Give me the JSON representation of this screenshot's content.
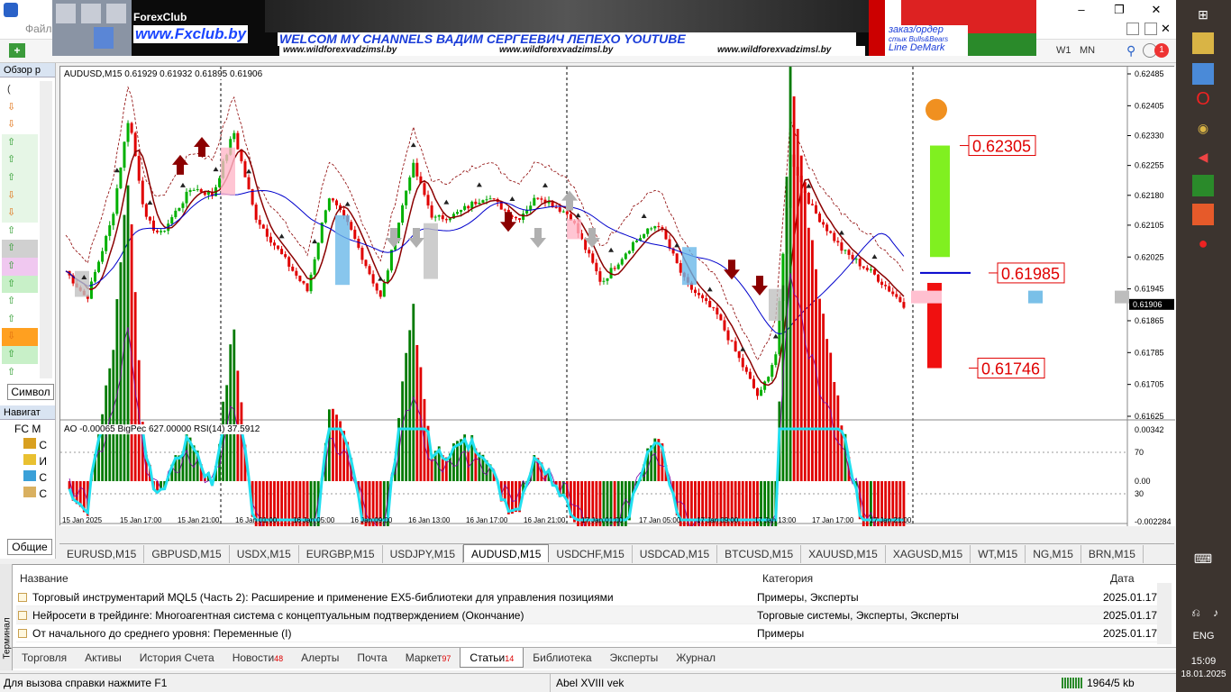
{
  "banner": {
    "forexclub": "ForexClub",
    "fxclub_url": "www.Fxclub.by",
    "headline": "WELCOM MY CHANNELS ВАДИМ СЕРГЕЕВИЧ ЛЕПЕХО YOUTUBE",
    "site1": "www.wildforexvadzimsl.by",
    "site2": "www.wildforexvadzimsl.by",
    "site3": "www.wildforexvadzimsl.by",
    "order": "заказ/ордер",
    "order2": "стык Bulls&Bears",
    "order3": "Line DeMark"
  },
  "menu": {
    "file": "Файл"
  },
  "toolbar": {
    "w1": "W1",
    "mn": "MN",
    "notif_count": "1"
  },
  "market_watch": {
    "title": "Обзор р",
    "symbol_tab": "Символ"
  },
  "navigator": {
    "title": "Навигат",
    "root": "FC M",
    "items": [
      "С",
      "И",
      "С",
      "С"
    ],
    "tab": "Общие"
  },
  "chart": {
    "header": "AUDUSD,M15  0.61929 0.61932 0.61895 0.61906",
    "indicator_header": "AO -0.00065  BigPec 627.00000  RSI(14) 37.5912",
    "price_labels": [
      "0.62485",
      "0.62405",
      "0.62330",
      "0.62255",
      "0.62180",
      "0.62105",
      "0.62025",
      "0.61945",
      "0.61865",
      "0.61785",
      "0.61705",
      "0.61625"
    ],
    "current_price": "0.61906",
    "level_high": "0.62305",
    "level_mid": "0.61985",
    "level_low": "0.61746",
    "ind_labels": [
      "0.00342",
      "70",
      "0.00",
      "30",
      "-0.002284"
    ],
    "time_labels": [
      "15 Jan 2025",
      "15 Jan 17:00",
      "15 Jan 21:00",
      "16 Jan 01:00",
      "16 Jan 05:00",
      "16 Jan 09:00",
      "16 Jan 13:00",
      "16 Jan 17:00",
      "16 Jan 21:00",
      "17 Jan 01:00",
      "17 Jan 05:00",
      "17 Jan 09:00",
      "17 Jan 13:00",
      "17 Jan 17:00",
      "17 Jan 21:00"
    ]
  },
  "symbol_tabs": [
    "EURUSD,M15",
    "GBPUSD,M15",
    "USDX,M15",
    "EURGBP,M15",
    "USDJPY,M15",
    "AUDUSD,M15",
    "USDCHF,M15",
    "USDCAD,M15",
    "BTCUSD,M15",
    "XAUUSD,M15",
    "XAGUSD,M15",
    "WT,M15",
    "NG,M15",
    "BRN,M15"
  ],
  "active_symbol_tab": "AUDUSD,M15",
  "terminal": {
    "side_label": "Терминал",
    "col_name": "Название",
    "col_category": "Категория",
    "col_date": "Дата",
    "rows": [
      {
        "name": "Торговый инструментарий MQL5 (Часть 2): Расширение и применение EX5-библиотеки для управления позициями",
        "category": "Примеры, Эксперты",
        "date": "2025.01.17"
      },
      {
        "name": "Нейросети в трейдинге: Многоагентная система с концептуальным подтверждением (Окончание)",
        "category": "Торговые системы, Эксперты, Эксперты",
        "date": "2025.01.17"
      },
      {
        "name": "От начального до среднего уровня: Переменные (I)",
        "category": "Примеры",
        "date": "2025.01.17"
      }
    ],
    "tabs": [
      {
        "label": "Торговля",
        "badge": ""
      },
      {
        "label": "Активы",
        "badge": ""
      },
      {
        "label": "История Счета",
        "badge": ""
      },
      {
        "label": "Новости",
        "badge": "48"
      },
      {
        "label": "Алерты",
        "badge": ""
      },
      {
        "label": "Почта",
        "badge": ""
      },
      {
        "label": "Маркет",
        "badge": "97"
      },
      {
        "label": "Статьи",
        "badge": "14"
      },
      {
        "label": "Библиотека",
        "badge": ""
      },
      {
        "label": "Эксперты",
        "badge": ""
      },
      {
        "label": "Журнал",
        "badge": ""
      }
    ],
    "active_tab": "Статьи"
  },
  "status": {
    "help": "Для вызова справки нажмите F1",
    "profile": "Abel XVIII vek",
    "traffic": "1964/5 kb"
  },
  "taskbar": {
    "lang": "ENG",
    "time": "15:09",
    "date": "18.01.2025"
  },
  "colors": {
    "bull": "#00a000",
    "bear": "#e00000",
    "ma": "#0000cc",
    "rsi": "#7b00a8",
    "cyan": "#22e0f0"
  }
}
